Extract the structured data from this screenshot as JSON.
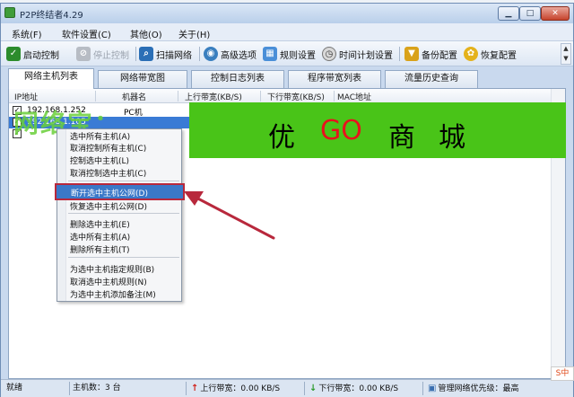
{
  "colors": {
    "accent": "#3a7bd5",
    "banner_green": "#49c418",
    "banner_red": "#e8121d",
    "highlight_border": "#b8283c",
    "arrow": "#b8283c"
  },
  "window": {
    "title": "P2P终结者4.29",
    "app_icon": "app-icon",
    "controls": [
      "minimize-icon",
      "maximize-icon",
      "close-icon"
    ]
  },
  "menu": {
    "items": [
      "系统(F)",
      "软件设置(C)",
      "其他(O)",
      "关于(H)"
    ]
  },
  "toolbar": {
    "items": [
      {
        "label": "启动控制",
        "icon": "check-icon",
        "color": "#2c8c2c",
        "enabled": true
      },
      {
        "label": "停止控制",
        "icon": "stop-icon",
        "color": "#b7bcc4",
        "enabled": false
      },
      {
        "label": "扫描网络",
        "icon": "scan-icon",
        "color": "#2b6fb6",
        "enabled": true
      },
      {
        "label": "高级选项",
        "icon": "globe-icon",
        "color": "#3a7fbf",
        "enabled": true
      },
      {
        "label": "规则设置",
        "icon": "rules-icon",
        "color": "#4a8fd8",
        "enabled": true
      },
      {
        "label": "时间计划设置",
        "icon": "clock-icon",
        "color": "#d8d8d8",
        "enabled": true
      },
      {
        "label": "备份配置",
        "icon": "backup-icon",
        "color": "#d9a21a",
        "enabled": true
      },
      {
        "label": "恢复配置",
        "icon": "restore-icon",
        "color": "#e4b21c",
        "enabled": true
      }
    ]
  },
  "tabs": [
    "网络主机列表",
    "网络带宽图",
    "控制日志列表",
    "程序带宽列表",
    "流量历史查询"
  ],
  "active_tab": 0,
  "list": {
    "columns": [
      "IP地址",
      "机器名",
      "上行带宽(KB/S)",
      "下行带宽(KB/S)",
      "MAC地址"
    ],
    "rows": [
      {
        "checked": true,
        "ip": "192.168.1.252",
        "name": "PC机",
        "selected": false
      },
      {
        "checked": true,
        "ip": "192.168.1.105",
        "name": "",
        "selected": true
      },
      {
        "checked": true,
        "ip": "",
        "name": "",
        "selected": false
      }
    ]
  },
  "banner": {
    "chars": [
      "优",
      "GO",
      "商",
      "城"
    ]
  },
  "watermark": {
    "text": "网络宝："
  },
  "context_menu": {
    "group1": [
      "选中所有主机(A)",
      "取消控制所有主机(C)",
      "控制选中主机(L)",
      "取消控制选中主机(C)"
    ],
    "highlighted": "断开选中主机公网(D)",
    "group2": [
      "恢复选中主机公网(D)"
    ],
    "group3": [
      "删除选中主机(E)",
      "选中所有主机(A)",
      "删除所有主机(T)"
    ],
    "group4": [
      "为选中主机指定规则(B)",
      "取消选中主机规则(N)",
      "为选中主机添加备注(M)"
    ]
  },
  "statusbar": {
    "ready": "就绪",
    "host_count": "主机数：3 台",
    "upload": "上行带宽：0.00 KB/S",
    "download": "下行带宽：0.00 KB/S",
    "priority": "管理网络优先级：最高"
  },
  "ime": {
    "label": "S中"
  }
}
